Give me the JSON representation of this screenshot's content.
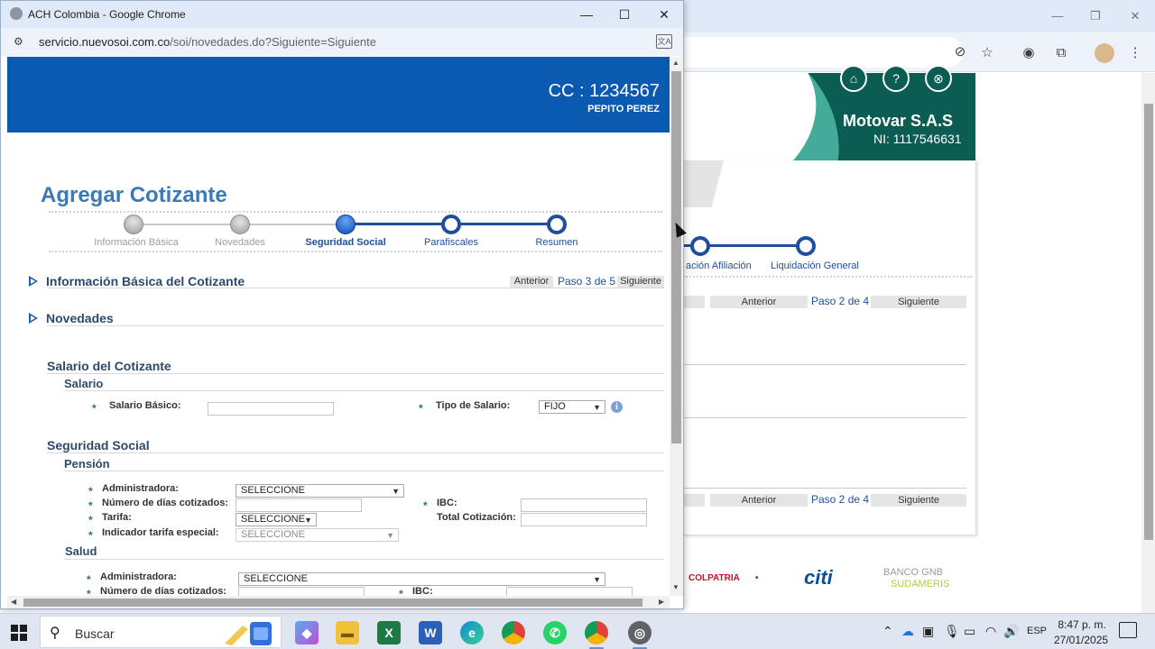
{
  "popup": {
    "window_title": "ACH Colombia - Google Chrome",
    "url_host": "servicio.nuevosoi.com.co",
    "url_path": "/soi/novedades.do?Siguiente=Siguiente",
    "header": {
      "cc": "CC : 1234567",
      "name": "PEPITO PEREZ"
    },
    "page_title": "Agregar Cotizante",
    "steps": [
      {
        "label": "Información Básica",
        "state": "done"
      },
      {
        "label": "Novedades",
        "state": "done"
      },
      {
        "label": "Seguridad Social",
        "state": "current"
      },
      {
        "label": "Parafiscales",
        "state": "todo"
      },
      {
        "label": "Resumen",
        "state": "todo"
      }
    ],
    "sections": {
      "info_basica": "Información Básica del Cotizante",
      "novedades": "Novedades"
    },
    "nav": {
      "anterior": "Anterior",
      "paso": "Paso 3 de 5",
      "siguiente": "Siguiente"
    },
    "salario": {
      "title": "Salario del Cotizante",
      "subtitle": "Salario",
      "basico_label": "Salario Básico:",
      "basico_value": "",
      "tipo_label": "Tipo de Salario:",
      "tipo_value": "FIJO"
    },
    "seguridad": {
      "title": "Seguridad Social",
      "pension": {
        "title": "Pensión",
        "administradora_label": "Administradora:",
        "administradora_value": "SELECCIONE",
        "dias_label": "Número de días cotizados:",
        "tarifa_label": "Tarifa:",
        "tarifa_value": "SELECCIONE",
        "indicador_label": "Indicador tarifa especial:",
        "indicador_value": "SELECCIONE",
        "ibc_label": "IBC:",
        "total_label": "Total Cotización:"
      },
      "salud": {
        "title": "Salud",
        "administradora_label": "Administradora:",
        "administradora_value": "SELECCIONE",
        "dias_label": "Número de días cotizados:",
        "ibc_label": "IBC:"
      }
    }
  },
  "background": {
    "company": "Motovar S.A.S",
    "nit": "NI: 1117546631",
    "steps": [
      {
        "label": "ación Afiliación"
      },
      {
        "label": "Liquidación General"
      }
    ],
    "nav": {
      "anterior": "Anterior",
      "paso": "Paso 2 de 4",
      "siguiente": "Siguiente"
    },
    "logos": [
      "COLPATRIA",
      "citi",
      "BANCO GNB",
      "SUDAMERIS"
    ]
  },
  "taskbar": {
    "search_placeholder": "Buscar",
    "lang": "ESP",
    "time": "8:47 p. m.",
    "date": "27/01/2025"
  },
  "colors": {
    "header_blue": "#0a5ab1",
    "title_blue": "#3b7ab8",
    "step_blue": "#1f4e9c",
    "bg_green": "#0b5c52"
  }
}
